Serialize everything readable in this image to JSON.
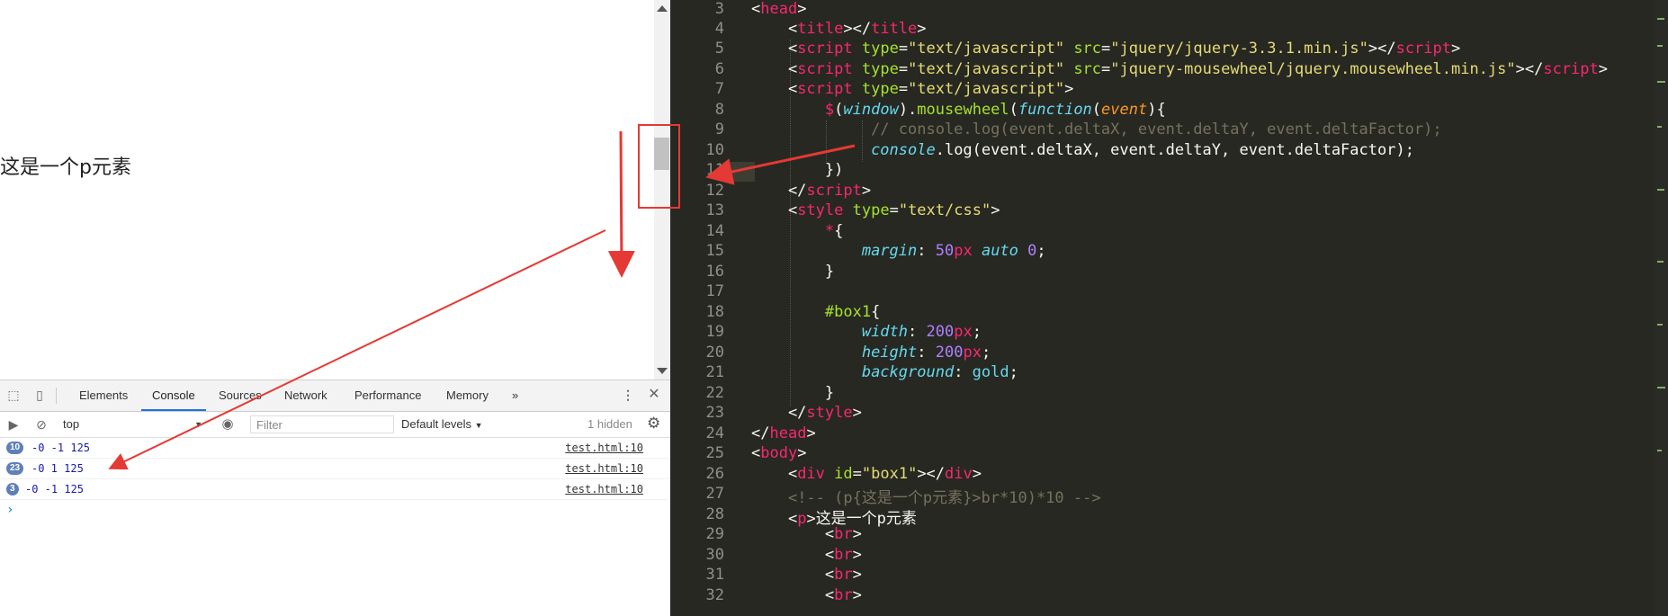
{
  "page": {
    "paragraph": "这是一个p元素"
  },
  "devtools": {
    "tabs": [
      "Elements",
      "Console",
      "Sources",
      "Network",
      "Performance",
      "Memory"
    ],
    "active_tab": "Console",
    "more_tabs": "»",
    "context": "top",
    "filter_placeholder": "Filter",
    "levels": "Default levels",
    "hidden": "1 hidden",
    "logs": [
      {
        "count": "10",
        "message": "-0 -1 125",
        "source": "test.html:10"
      },
      {
        "count": "23",
        "message": "-0 1 125",
        "source": "test.html:10"
      },
      {
        "count": "3",
        "message": "-0 -1 125",
        "source": "test.html:10"
      }
    ],
    "prompt": "›"
  },
  "editor": {
    "lines": [
      {
        "num": "3"
      },
      {
        "num": "4"
      },
      {
        "num": "5"
      },
      {
        "num": "6"
      },
      {
        "num": "7"
      },
      {
        "num": "8"
      },
      {
        "num": "9"
      },
      {
        "num": "10"
      },
      {
        "num": "11"
      },
      {
        "num": "12"
      },
      {
        "num": "13"
      },
      {
        "num": "14"
      },
      {
        "num": "15"
      },
      {
        "num": "16"
      },
      {
        "num": "17"
      },
      {
        "num": "18"
      },
      {
        "num": "19"
      },
      {
        "num": "20"
      },
      {
        "num": "21"
      },
      {
        "num": "22"
      },
      {
        "num": "23"
      },
      {
        "num": "24"
      },
      {
        "num": "25"
      },
      {
        "num": "26"
      },
      {
        "num": "27"
      },
      {
        "num": "28"
      },
      {
        "num": "29"
      },
      {
        "num": "30"
      },
      {
        "num": "31"
      },
      {
        "num": "32"
      }
    ],
    "code": {
      "l3_tag": "head",
      "l4_tag": "title",
      "l5_src": "\"jquery/jquery-3.3.1.min.js\"",
      "l6_src": "\"jquery-mousewheel/jquery.mousewheel.min.js\"",
      "type_js": "\"text/javascript\"",
      "l8_call": "mousewheel",
      "l8_win": "window",
      "l8_fn": "function",
      "l8_arg": "event",
      "l9_comment": "// console.log(event.deltaX, event.deltaY, event.deltaFactor);",
      "l10_console": "console",
      "l10_rest": ".log(event.deltaX, event.deltaY, event.deltaFactor);",
      "type_css": "\"text/css\"",
      "margin": "margin",
      "width": "width",
      "height": "height",
      "background": "background",
      "px50": "50",
      "px200": "200",
      "gold": "gold",
      "box1": "#box1",
      "box1_id": "\"box1\"",
      "l27_comment": "<!-- (p{这是一个p元素}>br*10)*10 -->",
      "l28_text": "这是一个p元素"
    }
  },
  "colors": {
    "annotation": "#e53935",
    "editor_bg": "#272822",
    "console_blue": "#1a1aa6"
  }
}
